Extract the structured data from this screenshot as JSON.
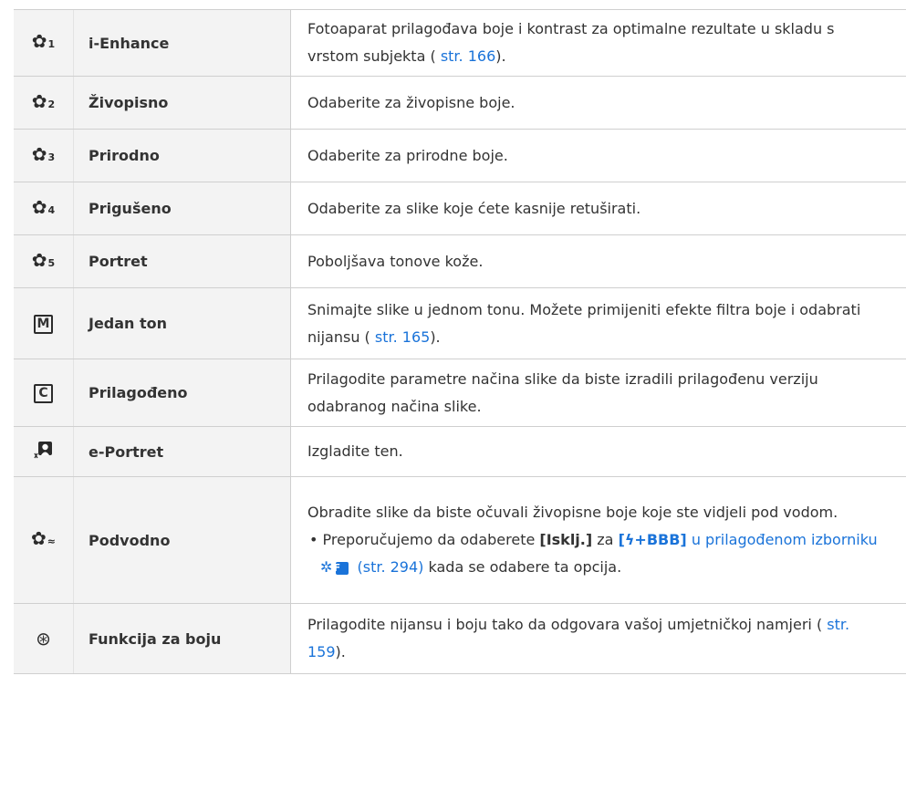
{
  "rows": [
    {
      "icon_sub": "1",
      "name": "i-Enhance",
      "desc_a": "Fotoaparat prilagođava boje i kontrast za optimalne rezultate u skladu s vrstom subjekta (",
      "link": "str. 166",
      "desc_b": ")."
    },
    {
      "icon_sub": "2",
      "name": "Živopisno",
      "desc": "Odaberite za živopisne boje."
    },
    {
      "icon_sub": "3",
      "name": "Prirodno",
      "desc": "Odaberite za prirodne boje."
    },
    {
      "icon_sub": "4",
      "name": "Prigušeno",
      "desc": "Odaberite za slike koje ćete kasnije retuširati."
    },
    {
      "icon_sub": "5",
      "name": "Portret",
      "desc": "Poboljšava tonove kože."
    },
    {
      "icon_letter": "M",
      "name": "Jedan ton",
      "desc_a": "Snimajte slike u jednom tonu. Možete primijeniti efekte filtra boje i odabrati nijansu (",
      "link": "str. 165",
      "desc_b": ")."
    },
    {
      "icon_letter": "C",
      "name": "Prilagođeno",
      "desc": "Prilagodite parametre načina slike da biste izradili prilagođenu verziju odabranog načina slike."
    },
    {
      "name": "e-Portret",
      "desc": "Izgladite ten."
    },
    {
      "name": "Podvodno",
      "desc": "Obradite slike da biste očuvali živopisne boje koje ste vidjeli pod vodom.",
      "bullet_a": "Preporučujemo da odaberete ",
      "bullet_bold": "[Isklj.]",
      "bullet_b": " za ",
      "bullet_link_bold": "[ϟ+BBB]",
      "bullet_link_a": " u prilagođenom izborniku ",
      "bullet_gear": "✲",
      "bullet_f": "F",
      "bullet_link_b": " (str. 294)",
      "bullet_c": " kada se odabere ta opcija."
    },
    {
      "name": "Funkcija za boju",
      "desc_a": "Prilagodite nijansu i boju tako da odgovara vašoj umjetničkoj namjeri (",
      "link": "str. 159",
      "desc_b": ")."
    }
  ]
}
